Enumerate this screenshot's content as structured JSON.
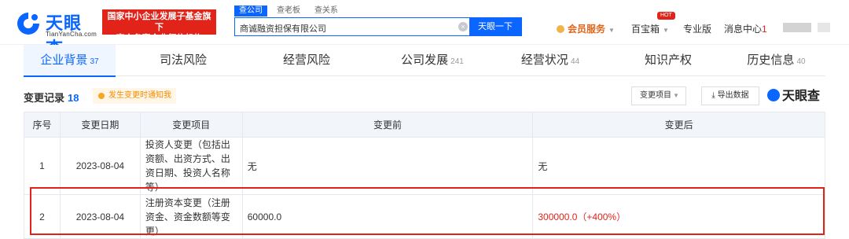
{
  "header": {
    "logo_text": "天眼查",
    "logo_sub": "TianYanCha.com",
    "badge_line1": "国家中小企业发展子基金旗下",
    "badge_line2": "官方备案企业征信机构",
    "search_tabs": [
      "查公司",
      "查老板",
      "查关系"
    ],
    "search_value": "商诚融资担保有限公司",
    "search_button": "天眼一下",
    "vip_label": "会员服务",
    "treasure_label": "百宝箱",
    "hot_tag": "HOT",
    "pro_label": "专业版",
    "msg_label": "消息中心",
    "msg_count": "1"
  },
  "tabs": [
    {
      "label": "企业背景",
      "count": "37"
    },
    {
      "label": "司法风险",
      "count": ""
    },
    {
      "label": "经营风险",
      "count": ""
    },
    {
      "label": "公司发展",
      "count": "241"
    },
    {
      "label": "经营状况",
      "count": "44"
    },
    {
      "label": "知识产权",
      "count": ""
    },
    {
      "label": "历史信息",
      "count": "40"
    }
  ],
  "section": {
    "title": "变更记录",
    "count": "18",
    "notice": "发生变更时通知我",
    "select_label": "变更项目",
    "export_label": "导出数据",
    "watermark": "天眼查"
  },
  "table": {
    "headers": [
      "序号",
      "变更日期",
      "变更项目",
      "变更前",
      "变更后"
    ],
    "rows": [
      {
        "no": "1",
        "date": "2023-08-04",
        "item": "投资人变更（包括出资额、出资方式、出资日期、投资人名称等）",
        "before": "无",
        "after": "无"
      },
      {
        "no": "2",
        "date": "2023-08-04",
        "item": "注册资本变更（注册资金、资金数额等变更）",
        "before": "60000.0",
        "after": "300000.0（+400%）"
      }
    ]
  },
  "colors": {
    "brand": "#0a66ff",
    "alert": "#e2231a"
  }
}
